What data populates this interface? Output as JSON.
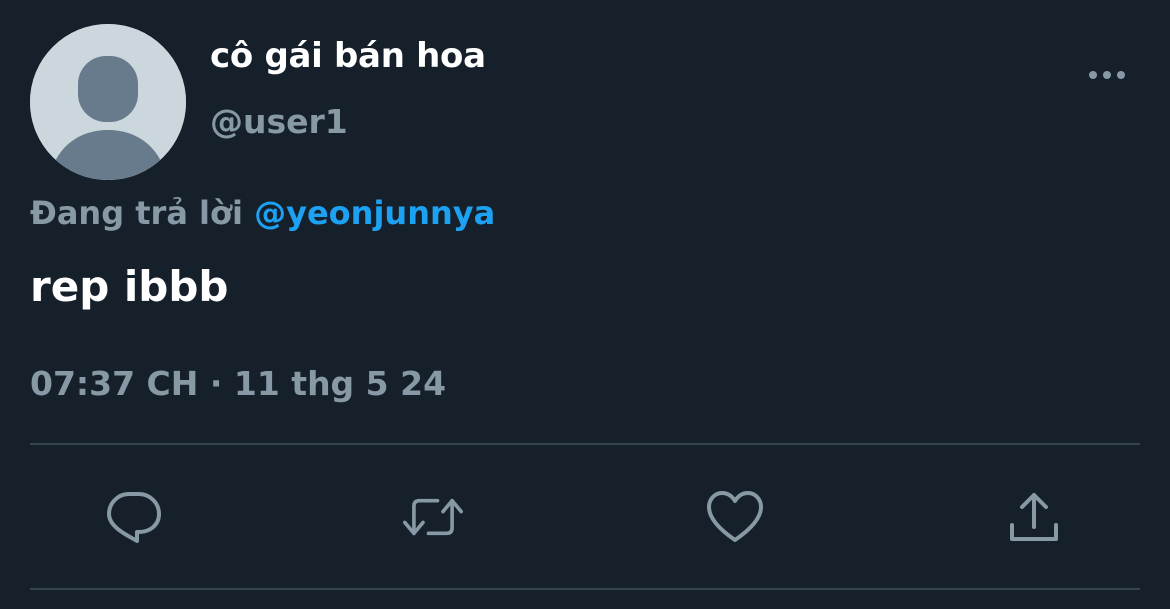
{
  "tweet": {
    "author": {
      "display_name": "cô gái bán hoa",
      "handle": "@user1",
      "avatar_icon": "default-avatar-icon"
    },
    "reply_context": {
      "prefix": "Đang trả lời",
      "mention": "@yeonjunnya"
    },
    "text": "rep ibbb",
    "timestamp": "07:37 CH · 11 thg 5 24",
    "more_icon": "more-horizontal-icon"
  },
  "actions": [
    {
      "name": "reply",
      "icon": "reply-icon"
    },
    {
      "name": "retweet",
      "icon": "retweet-icon"
    },
    {
      "name": "like",
      "icon": "heart-icon"
    },
    {
      "name": "share",
      "icon": "share-icon"
    }
  ],
  "colors": {
    "background": "#15202b",
    "primary_text": "#ffffff",
    "secondary_text": "#8899a6",
    "accent": "#1da1f2",
    "divider": "#38444d",
    "avatar_bg": "#ccd6dd",
    "avatar_fg": "#687b8c"
  }
}
